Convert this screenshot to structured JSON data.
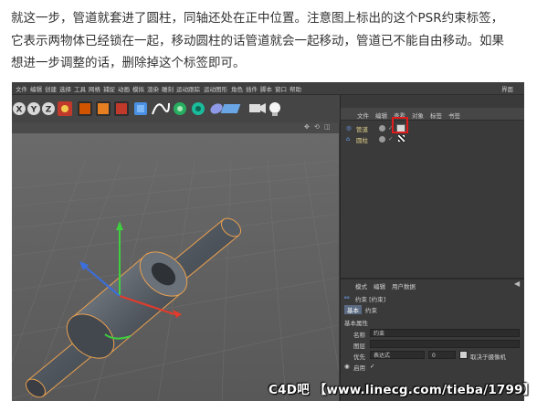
{
  "article": {
    "lines": [
      "就这一步，管道就套进了圆柱，同轴还处在正中位置。注意图上标出的这个PSR约束标签，",
      "它表示两物体已经锁在一起，移动圆柱的话管道就会一起移动，管道已不能自由移动。如果",
      "想进一步调整的话，删除掉这个标签即可。"
    ]
  },
  "app": {
    "menu": [
      "文件",
      "编辑",
      "创建",
      "选择",
      "工具",
      "网格",
      "捕捉",
      "动画",
      "模拟",
      "渲染",
      "雕刻",
      "运动跟踪",
      "运动图形",
      "角色",
      "插件",
      "脚本",
      "窗口",
      "帮助"
    ],
    "layout_label": "界面",
    "object_tabs": [
      "文件",
      "编辑",
      "查看",
      "对象",
      "标签",
      "书签"
    ],
    "objects": [
      {
        "name": "管道",
        "color": "#e8d27a"
      },
      {
        "name": "圆柱",
        "color": "#e8d27a"
      }
    ],
    "attributes": {
      "tabs": [
        "模式",
        "编辑",
        "用户数据"
      ],
      "title": "约束 [约束]",
      "subtabs": [
        "基本",
        "约束"
      ],
      "section": "基本属性",
      "name_label": "名称",
      "name_value": "约束",
      "layer_label": "图层",
      "priority_label": "优先",
      "priority_value": "表达式",
      "priority_num": "0",
      "camera_label": "取决于摄像机",
      "enable_label": "启用"
    }
  },
  "watermark": "C4D吧 【www.linecg.com/tieba/1799】",
  "colors": {
    "highlight": "#e11b1b",
    "axis_x": "#e23b2b",
    "axis_y": "#3fcf3f",
    "axis_z": "#3a6fe0",
    "object": "#5a6068",
    "selection": "#e8a050"
  },
  "icons": [
    "x-axis-icon",
    "y-axis-icon",
    "z-axis-icon",
    "world-icon",
    "render-icon",
    "cube-icon",
    "spline-icon",
    "nurbs-icon",
    "deformer-icon",
    "camera-icon",
    "light-icon",
    "psr-constraint-tag-icon"
  ]
}
